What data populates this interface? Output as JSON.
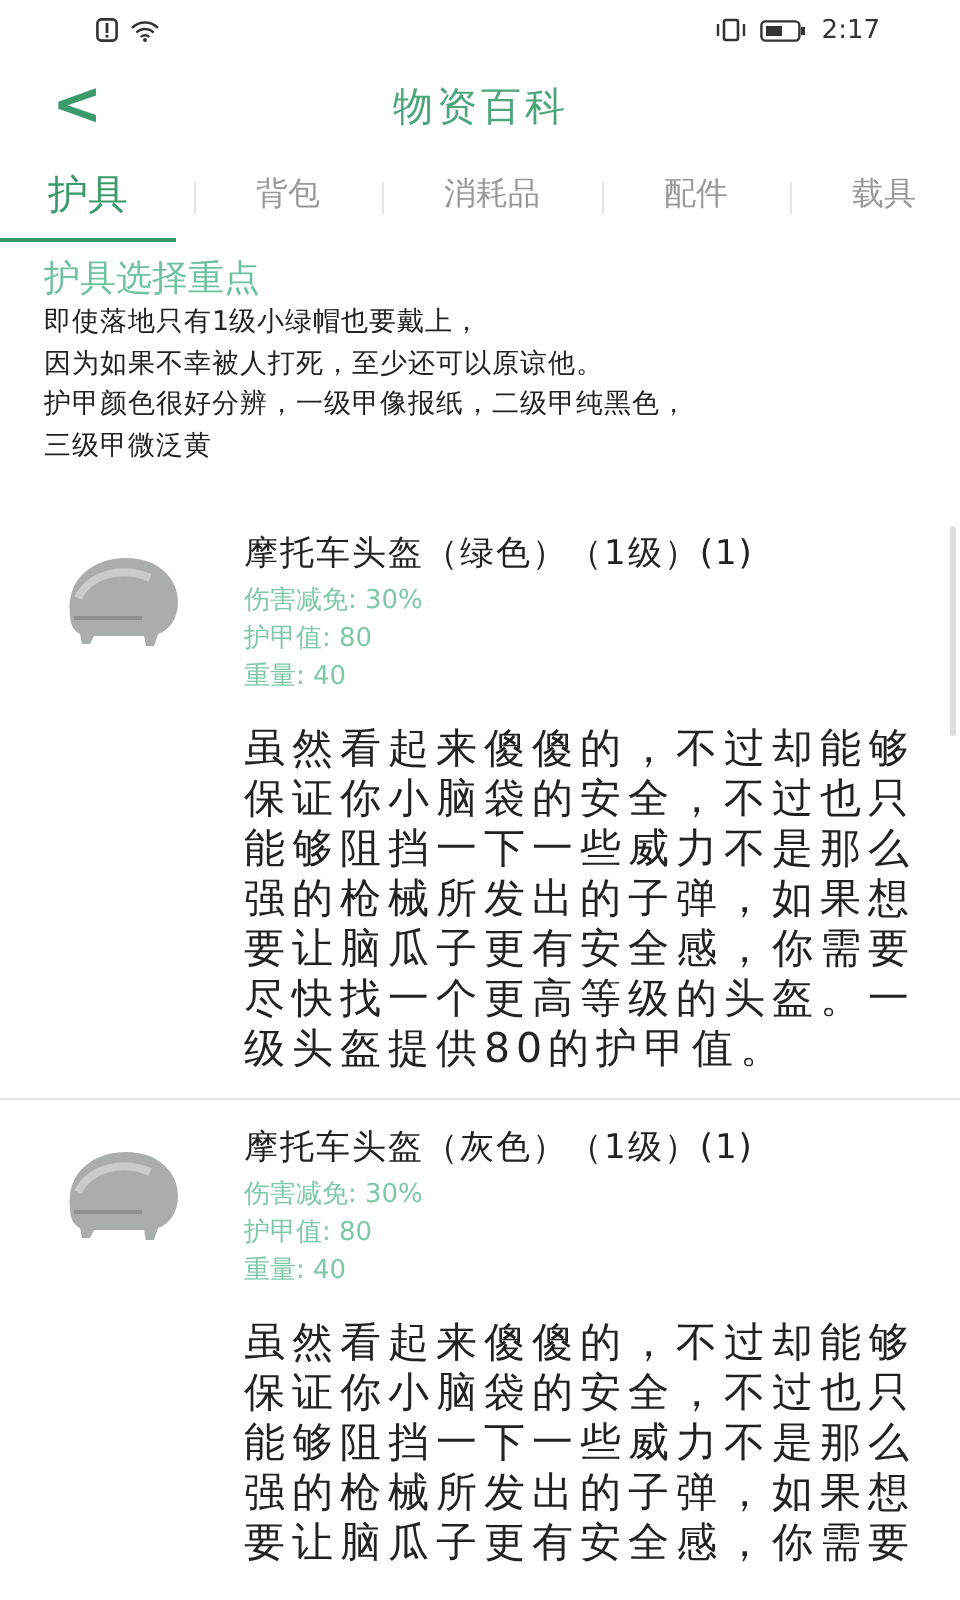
{
  "status_bar": {
    "time": "2:17"
  },
  "header": {
    "back": "<",
    "title": "物资百科"
  },
  "tabs": [
    {
      "label": "护具",
      "selected": true
    },
    {
      "label": "背包",
      "selected": false
    },
    {
      "label": "消耗品",
      "selected": false
    },
    {
      "label": "配件",
      "selected": false
    },
    {
      "label": "载具",
      "selected": false
    }
  ],
  "intro": {
    "title": "护具选择重点",
    "lines": [
      "即使落地只有1级小绿帽也要戴上，",
      "因为如果不幸被人打死，至少还可以原谅他。",
      "护甲颜色很好分辨，一级甲像报纸，二级甲纯黑色，",
      "三级甲微泛黄"
    ]
  },
  "items": [
    {
      "name": "摩托车头盔（绿色）（1级）(1)",
      "stats": [
        "伤害减免: 30%",
        "护甲值: 80",
        "重量: 40"
      ],
      "description": "虽然看起来傻傻的，不过却能够保证你小脑袋的安全，不过也只能够阻挡一下一些威力不是那么强的枪械所发出的子弹，如果想要让脑瓜子更有安全感，你需要尽快找一个更高等级的头盔。一级头盔提供80的护甲值。"
    },
    {
      "name": "摩托车头盔（灰色）（1级）(1)",
      "stats": [
        "伤害减免: 30%",
        "护甲值: 80",
        "重量: 40"
      ],
      "description": "虽然看起来傻傻的，不过却能够保证你小脑袋的安全，不过也只能够阻挡一下一些威力不是那么强的枪械所发出的子弹，如果想要让脑瓜子更有安全感，你需要"
    }
  ]
}
